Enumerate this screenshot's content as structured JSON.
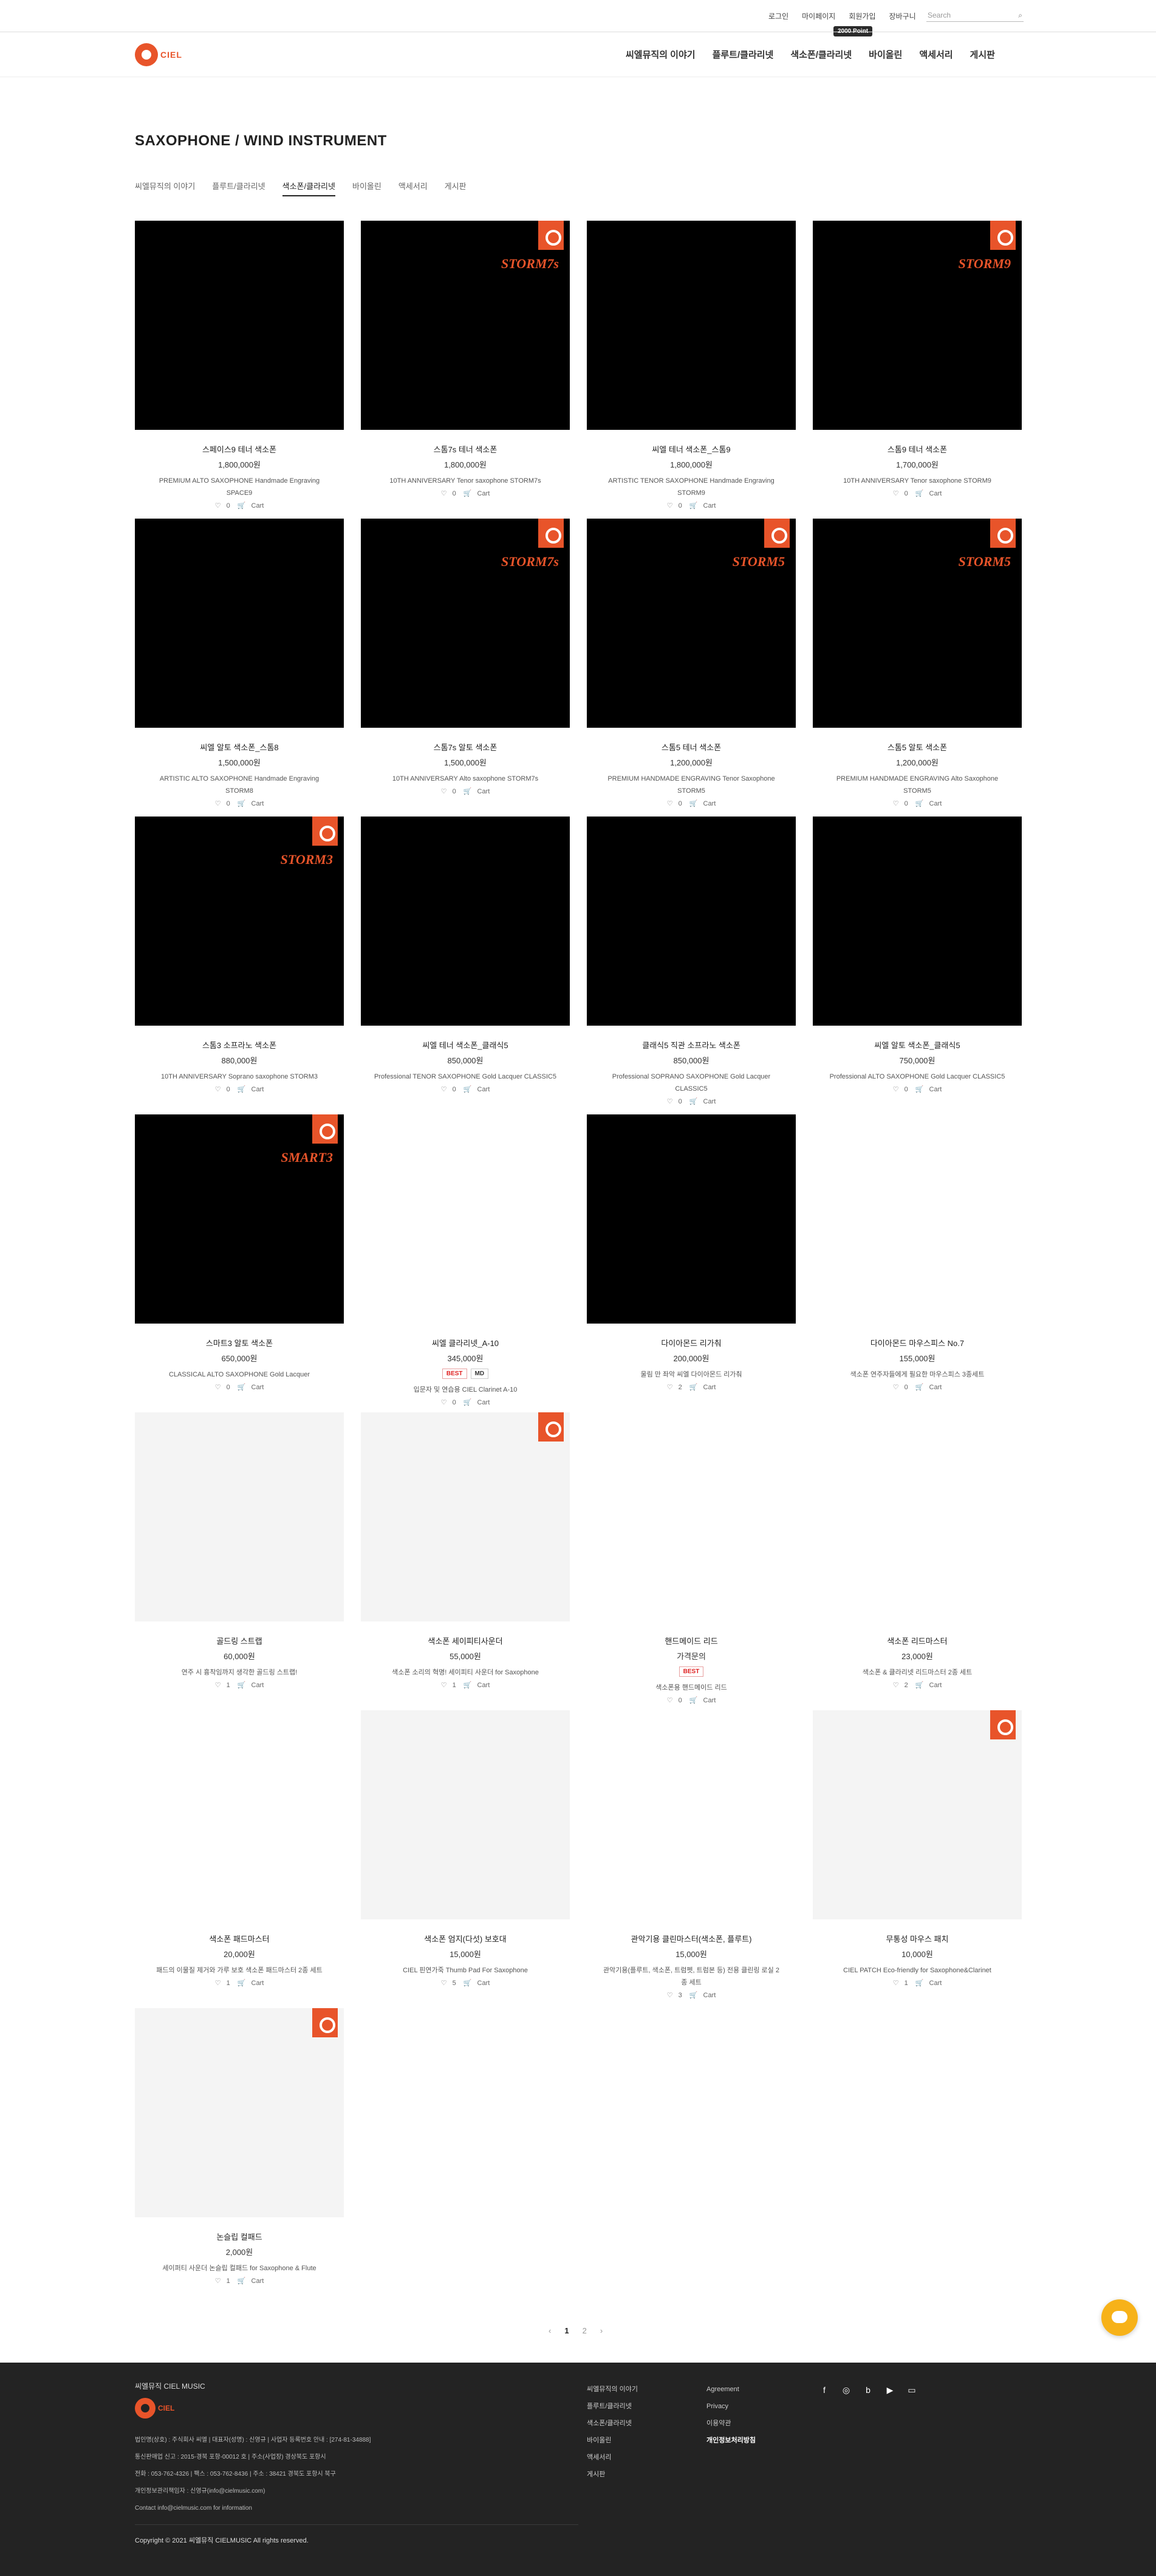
{
  "topbar": {
    "links": [
      "로그인",
      "마이페이지",
      "회원가입",
      "장바구니"
    ],
    "search_placeholder": "Search",
    "tooltip": "2000 Point"
  },
  "header": {
    "logo_text": "CIEL",
    "nav": [
      "씨엘뮤직의 이야기",
      "플루트/클라리넷",
      "색소폰/클라리넷",
      "바이올린",
      "액세서리",
      "게시판"
    ]
  },
  "page": {
    "title": "SAXOPHONE / WIND INSTRUMENT",
    "subnav": [
      "씨엘뮤직의 이야기",
      "플루트/클라리넷",
      "색소폰/클라리넷",
      "바이올린",
      "액세서리",
      "게시판"
    ],
    "active_subnav": 2
  },
  "products": [
    {
      "name": "스페이스9 테너 색소폰",
      "price": "1,800,000원",
      "desc": "PREMIUM ALTO SAXOPHONE Handmade Engraving SPACE9",
      "likes": "0",
      "cart": "Cart",
      "theme": "dark",
      "badge": false
    },
    {
      "name": "스톰7s 테너 색소폰",
      "price": "1,800,000원",
      "desc": "10TH ANNIVERSARY Tenor saxophone STORM7s",
      "likes": "0",
      "cart": "Cart",
      "theme": "dark",
      "badge": true,
      "model": "STORM7s"
    },
    {
      "name": "씨엘 테너 색소폰_스톰9",
      "price": "1,800,000원",
      "desc": "ARTISTIC TENOR SAXOPHONE Handmade Engraving STORM9",
      "likes": "0",
      "cart": "Cart",
      "theme": "dark",
      "badge": false
    },
    {
      "name": "스톰9 테너 색소폰",
      "price": "1,700,000원",
      "desc": "10TH ANNIVERSARY Tenor saxophone STORM9",
      "likes": "0",
      "cart": "Cart",
      "theme": "dark",
      "badge": true,
      "model": "STORM9"
    },
    {
      "name": "씨엘 알토 색소폰_스톰8",
      "price": "1,500,000원",
      "desc": "ARTISTIC ALTO SAXOPHONE Handmade Engraving STORM8",
      "likes": "0",
      "cart": "Cart",
      "theme": "dark",
      "badge": false
    },
    {
      "name": "스톰7s 알토 색소폰",
      "price": "1,500,000원",
      "desc": "10TH ANNIVERSARY Alto saxophone STORM7s",
      "likes": "0",
      "cart": "Cart",
      "theme": "dark",
      "badge": true,
      "model": "STORM7s"
    },
    {
      "name": "스톰5 테너 색소폰",
      "price": "1,200,000원",
      "desc": "PREMIUM HANDMADE ENGRAVING Tenor Saxophone STORM5",
      "likes": "0",
      "cart": "Cart",
      "theme": "dark",
      "badge": true,
      "model": "STORM5"
    },
    {
      "name": "스톰5 알토 색소폰",
      "price": "1,200,000원",
      "desc": "PREMIUM HANDMADE ENGRAVING Alto Saxophone STORM5",
      "likes": "0",
      "cart": "Cart",
      "theme": "dark",
      "badge": true,
      "model": "STORM5"
    },
    {
      "name": "스톰3 소프라노 색소폰",
      "price": "880,000원",
      "desc": "10TH ANNIVERSARY Soprano saxophone STORM3",
      "likes": "0",
      "cart": "Cart",
      "theme": "dark",
      "badge": true,
      "model": "STORM3"
    },
    {
      "name": "씨엘 테너 색소폰_클래식5",
      "price": "850,000원",
      "desc": "Professional TENOR SAXOPHONE Gold Lacquer CLASSIC5",
      "likes": "0",
      "cart": "Cart",
      "theme": "dark",
      "badge": false
    },
    {
      "name": "클래식5 직관 소프라노 색소폰",
      "price": "850,000원",
      "desc": "Professional SOPRANO SAXOPHONE Gold Lacquer CLASSIC5",
      "likes": "0",
      "cart": "Cart",
      "theme": "dark",
      "badge": false
    },
    {
      "name": "씨엘 알토 색소폰_클래식5",
      "price": "750,000원",
      "desc": "Professional ALTO SAXOPHONE Gold Lacquer CLASSIC5",
      "likes": "0",
      "cart": "Cart",
      "theme": "dark",
      "badge": false
    },
    {
      "name": "스마트3 알토 색소폰",
      "price": "650,000원",
      "desc": "CLASSICAL ALTO SAXOPHONE Gold Lacquer",
      "likes": "0",
      "cart": "Cart",
      "theme": "dark",
      "badge": true,
      "model": "SMART3"
    },
    {
      "name": "씨엘 클라리넷_A-10",
      "price": "345,000원",
      "desc": "입문자 및 연습용 CIEL Clarinet A-10",
      "likes": "0",
      "cart": "Cart",
      "theme": "white",
      "badge": false,
      "tags": [
        "BEST",
        "MD"
      ]
    },
    {
      "name": "다이아몬드 리가춰",
      "price": "200,000원",
      "desc": "울림 만 좌악 씨엘 다이아몬드 리가춰",
      "likes": "2",
      "cart": "Cart",
      "theme": "dark",
      "badge": false
    },
    {
      "name": "다이아몬드 마우스피스 No.7",
      "price": "155,000원",
      "desc": "색소폰 연주자들에게 필요한 마우스피스 3종세트",
      "likes": "0",
      "cart": "Cart",
      "theme": "white",
      "badge": false
    },
    {
      "name": "골드링 스트랩",
      "price": "60,000원",
      "desc": "연주 시 흉착임까지 생각한 골드링 스트랩!",
      "likes": "1",
      "cart": "Cart",
      "theme": "light",
      "badge": false
    },
    {
      "name": "색소폰 세이피티사운더",
      "price": "55,000원",
      "desc": "색소폰 소리의 혁명! 세이피티 사운더 for Saxophone",
      "likes": "1",
      "cart": "Cart",
      "theme": "light",
      "badge": true
    },
    {
      "name": "핸드메이드 리드",
      "price": "가격문의",
      "desc": "색소폰용 핸드메이드 리드",
      "likes": "0",
      "cart": "Cart",
      "theme": "white",
      "badge": false,
      "tags": [
        "BEST"
      ]
    },
    {
      "name": "색소폰 리드마스터",
      "price": "23,000원",
      "desc": "색소폰 & 클라리넷 리드마스터 2종 세트",
      "likes": "2",
      "cart": "Cart",
      "theme": "white",
      "badge": false
    },
    {
      "name": "색소폰 패드마스터",
      "price": "20,000원",
      "desc": "패드의 이물질 제거와 가루 보호 색소폰 패드마스터 2종 세트",
      "likes": "1",
      "cart": "Cart",
      "theme": "white",
      "badge": false
    },
    {
      "name": "색소폰 엄지(다섯) 보호대",
      "price": "15,000원",
      "desc": "CIEL 핀연가죽 Thumb Pad For Saxophone",
      "likes": "5",
      "cart": "Cart",
      "theme": "light",
      "badge": false
    },
    {
      "name": "관악기용 클린마스터(색소폰, 플루트)",
      "price": "15,000원",
      "desc": "관악기용(플루트, 색소폰, 트럼펫, 트럼본 등) 전용 클린링 로실 2종 세트",
      "likes": "3",
      "cart": "Cart",
      "theme": "white",
      "badge": false
    },
    {
      "name": "무통성 마우스 패치",
      "price": "10,000원",
      "desc": "CIEL PATCH Eco-friendly for Saxophone&Clarinet",
      "likes": "1",
      "cart": "Cart",
      "theme": "light",
      "badge": true
    },
    {
      "name": "논슬립 컬패드",
      "price": "2,000원",
      "desc": "세이퍼티 사운더 논슬립 컬패드 for Saxophone & Flute",
      "likes": "1",
      "cart": "Cart",
      "theme": "light",
      "badge": true
    }
  ],
  "pagination": {
    "prev": "‹",
    "pages": [
      "1",
      "2"
    ],
    "current": "1",
    "next": "›"
  },
  "footer": {
    "brand": "씨엘뮤직 CIEL MUSIC",
    "logo_text": "CIEL",
    "info": [
      "법인명(상호) : 주식회사 씨엘 | 대표자(성명) : 신영규 | 사업자 등록번호 안내 : [274-81-34888]",
      "통신판매업 신고 : 2015-경북 포항-00012 호 | 주소(사업장) 경상북도 포항시",
      "전화 : 053-762-4326 | 팩스 : 053-762-8436 | 주소 : 38421 경북도 포항시 북구",
      "개인정보관리책임자 : 신영규(info@cielmusic.com)",
      "Contact info@cielmusic.com for information"
    ],
    "copyright": "Copyright © 2021 씨엘뮤직 CIELMUSIC All rights reserved.",
    "col1": [
      "씨엘뮤직의 이야기",
      "플루트/클라리넷",
      "색소폰/클라리넷",
      "바이올린",
      "액세서리",
      "게시판"
    ],
    "col2": [
      "Agreement",
      "Privacy",
      "이용약관",
      "개인정보처리방침"
    ],
    "social": [
      "facebook-icon",
      "instagram-icon",
      "blog-icon",
      "youtube-icon",
      "talk-icon"
    ]
  },
  "colors": {
    "accent": "#e8542a",
    "footer_bg": "#232323",
    "chat": "#f7b219"
  }
}
